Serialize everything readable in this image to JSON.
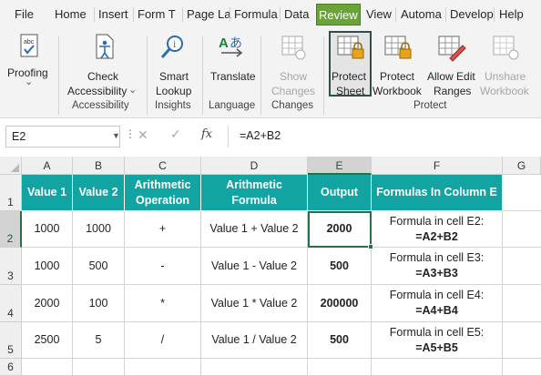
{
  "menu": {
    "tabs": [
      {
        "label": "File"
      },
      {
        "label": "Home"
      },
      {
        "label": "Insert"
      },
      {
        "label": "Form T"
      },
      {
        "label": "Page La"
      },
      {
        "label": "Formula"
      },
      {
        "label": "Data"
      },
      {
        "label": "Review",
        "active": true
      },
      {
        "label": "View"
      },
      {
        "label": "Automa"
      },
      {
        "label": "Develop"
      },
      {
        "label": "Help"
      }
    ]
  },
  "ribbon": {
    "proofing": {
      "label": "Proofing",
      "icon": "abc-check-icon",
      "dropdown_arrow": "⌄"
    },
    "accessibility": {
      "button_line1": "Check",
      "button_line2": "Accessibility",
      "dropdown_arrow": "⌄",
      "group": "Accessibility",
      "icon": "accessibility-icon"
    },
    "insights": {
      "button_line1": "Smart",
      "button_line2": "Lookup",
      "group": "Insights",
      "icon": "smart-lookup-icon"
    },
    "language": {
      "button_line1": "Translate",
      "group": "Language",
      "icon": "translate-icon"
    },
    "changes": {
      "button_line1": "Show",
      "button_line2": "Changes",
      "group": "Changes",
      "icon": "show-changes-icon",
      "disabled": true
    },
    "protect": {
      "group": "Protect",
      "buttons": [
        {
          "line1": "Protect",
          "line2": "Sheet",
          "icon": "protect-sheet-icon",
          "highlighted": true
        },
        {
          "line1": "Protect",
          "line2": "Workbook",
          "icon": "protect-workbook-icon"
        },
        {
          "line1": "Allow Edit",
          "line2": "Ranges",
          "icon": "allow-edit-ranges-icon"
        },
        {
          "line1": "Unshare",
          "line2": "Workbook",
          "icon": "unshare-workbook-icon",
          "disabled": true
        }
      ]
    },
    "accent_color": "#6aa336"
  },
  "formula_bar": {
    "name_box": "E2",
    "dots": "⋮",
    "cancel": "✕",
    "enter": "✓",
    "fx": "fx",
    "formula": "=A2+B2"
  },
  "sheet": {
    "columns": [
      "A",
      "B",
      "C",
      "D",
      "E",
      "F",
      "G"
    ],
    "rows": [
      "1",
      "2",
      "3",
      "4",
      "5",
      "6"
    ],
    "header_color": "#12a3a3",
    "selected_column": "E",
    "selected_row": "2",
    "headers": {
      "A": "Value 1",
      "B": "Value 2",
      "C1": "Arithmetic",
      "C2": "Operation",
      "D1": "Arithmetic",
      "D2": "Formula",
      "E": "Output",
      "F": "Formulas In Column E"
    },
    "data": [
      {
        "a": "1000",
        "b": "1000",
        "op": "+",
        "formula": "Value 1 + Value 2",
        "out": "2000",
        "f1": "Formula in cell E2:",
        "f2": "=A2+B2"
      },
      {
        "a": "1000",
        "b": "500",
        "op": "-",
        "formula": "Value 1 - Value 2",
        "out": "500",
        "f1": "Formula in cell E3:",
        "f2": "=A3+B3"
      },
      {
        "a": "2000",
        "b": "100",
        "op": "*",
        "formula": "Value 1 * Value 2",
        "out": "200000",
        "f1": "Formula in cell E4:",
        "f2": "=A4+B4"
      },
      {
        "a": "2500",
        "b": "5",
        "op": "/",
        "formula": "Value 1 / Value 2",
        "out": "500",
        "f1": "Formula in cell E5:",
        "f2": "=A5+B5"
      }
    ]
  }
}
